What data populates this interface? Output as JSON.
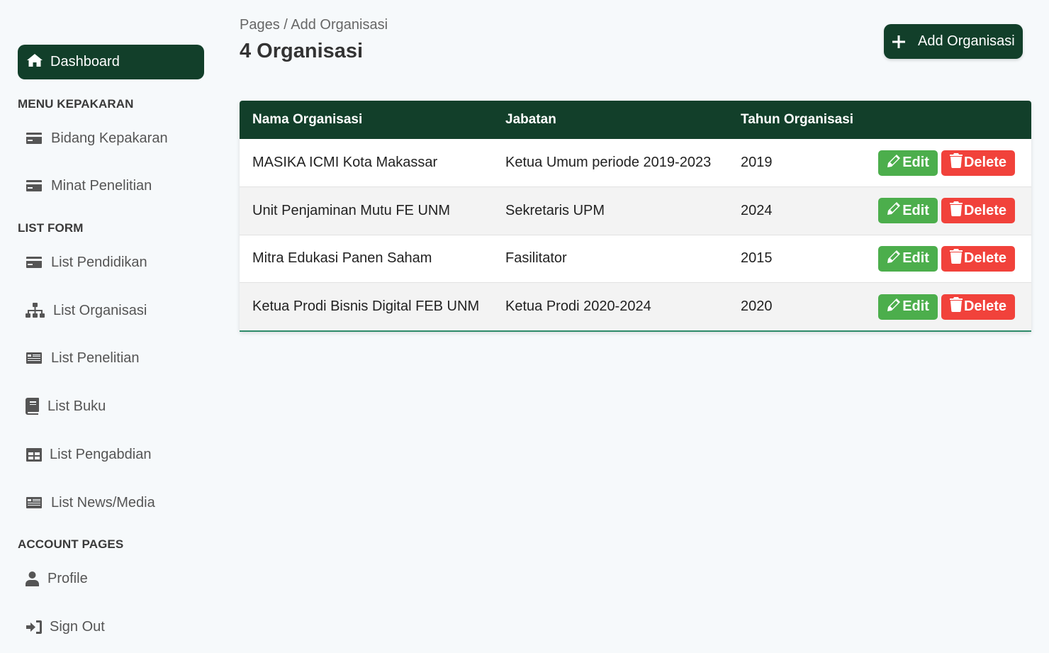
{
  "sidebar": {
    "dashboard_label": "Dashboard",
    "sections": {
      "kepakaran": "MENU KEPAKARAN",
      "list_form": "LIST FORM",
      "account": "ACCOUNT PAGES"
    },
    "items": {
      "bidang": "Bidang Kepakaran",
      "minat": "Minat Penelitian",
      "pendidikan": "List Pendidikan",
      "organisasi": "List Organisasi",
      "penelitian": "List Penelitian",
      "buku": "List Buku",
      "pengabdian": "List Pengabdian",
      "news": "List News/Media",
      "profile": "Profile",
      "signout": "Sign Out"
    }
  },
  "header": {
    "breadcrumb": "Pages / Add Organisasi",
    "title": "4 Organisasi",
    "add_button": "Add Organisasi"
  },
  "table": {
    "columns": [
      "Nama Organisasi",
      "Jabatan",
      "Tahun Organisasi"
    ],
    "rows": [
      {
        "nama": "MASIKA ICMI Kota Makassar",
        "jabatan": "Ketua Umum periode 2019-2023",
        "tahun": "2019"
      },
      {
        "nama": "Unit Penjaminan Mutu FE UNM",
        "jabatan": "Sekretaris UPM",
        "tahun": "2024"
      },
      {
        "nama": "Mitra Edukasi Panen Saham",
        "jabatan": "Fasilitator",
        "tahun": "2015"
      },
      {
        "nama": "Ketua Prodi Bisnis Digital FEB UNM",
        "jabatan": "Ketua Prodi 2020-2024",
        "tahun": "2020"
      }
    ],
    "edit_label": "Edit",
    "delete_label": "Delete"
  },
  "colors": {
    "primary": "#123f2a",
    "edit": "#4cae4c",
    "delete": "#f1423b",
    "background": "#f6f9fb"
  }
}
